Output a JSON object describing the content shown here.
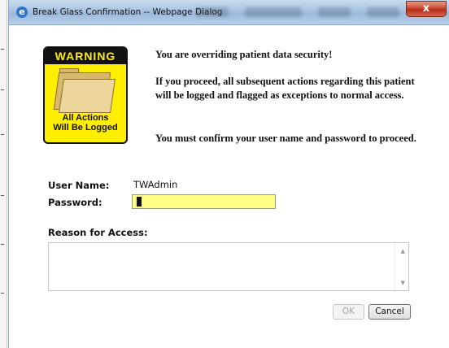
{
  "window": {
    "title": "Break Glass Confirmation -- Webpage Dialog",
    "close_glyph": "x"
  },
  "warning_sign": {
    "header": "WARNING",
    "caption_line1": "All Actions",
    "caption_line2": "Will Be Logged",
    "icon": "folder-icon"
  },
  "messages": [
    "You are overriding patient data security!",
    "If you proceed, all subsequent actions regarding this patient will be logged and flagged as exceptions to normal access.",
    "You must confirm your user name and password to proceed."
  ],
  "form": {
    "user_name_label": "User Name:",
    "user_name_value": "TWAdmin",
    "password_label": "Password:",
    "reason_label": "Reason for Access:",
    "reason_value": ""
  },
  "buttons": {
    "ok_label": "OK",
    "cancel_label": "Cancel"
  },
  "colors": {
    "warning_yellow": "#ffee00",
    "password_highlight": "#ffff88",
    "title_bar": "#a8c3e2",
    "close_red": "#c8412b"
  }
}
